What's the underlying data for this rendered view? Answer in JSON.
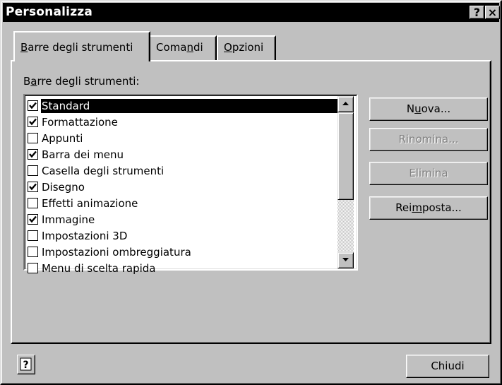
{
  "window": {
    "title": "Personalizza",
    "help_button": "?",
    "close_button": "×"
  },
  "tabs": [
    {
      "pre": "",
      "accel": "B",
      "post": "arre degli strumenti",
      "active": true
    },
    {
      "pre": "Coma",
      "accel": "n",
      "post": "di",
      "active": false
    },
    {
      "pre": "",
      "accel": "O",
      "post": "pzioni",
      "active": false
    }
  ],
  "toolbars": {
    "label_pre": "B",
    "label_accel": "a",
    "label_post": "rre degli strumenti:",
    "items": [
      {
        "label": "Standard",
        "checked": true,
        "selected": true
      },
      {
        "label": "Formattazione",
        "checked": true,
        "selected": false
      },
      {
        "label": "Appunti",
        "checked": false,
        "selected": false
      },
      {
        "label": "Barra dei menu",
        "checked": true,
        "selected": false
      },
      {
        "label": "Casella degli strumenti",
        "checked": false,
        "selected": false
      },
      {
        "label": "Disegno",
        "checked": true,
        "selected": false
      },
      {
        "label": "Effetti animazione",
        "checked": false,
        "selected": false
      },
      {
        "label": "Immagine",
        "checked": true,
        "selected": false
      },
      {
        "label": "Impostazioni 3D",
        "checked": false,
        "selected": false
      },
      {
        "label": "Impostazioni ombreggiatura",
        "checked": false,
        "selected": false
      },
      {
        "label": "Menu di scelta rapida",
        "checked": false,
        "selected": false
      }
    ]
  },
  "buttons": {
    "nuova": {
      "pre": "N",
      "accel": "u",
      "post": "ova..."
    },
    "rinomina": {
      "label": "Rinomina..."
    },
    "elimina": {
      "label": "Elimina"
    },
    "reimposta": {
      "pre": "Rei",
      "accel": "m",
      "post": "posta..."
    },
    "chiudi": {
      "label": "Chiudi"
    }
  }
}
